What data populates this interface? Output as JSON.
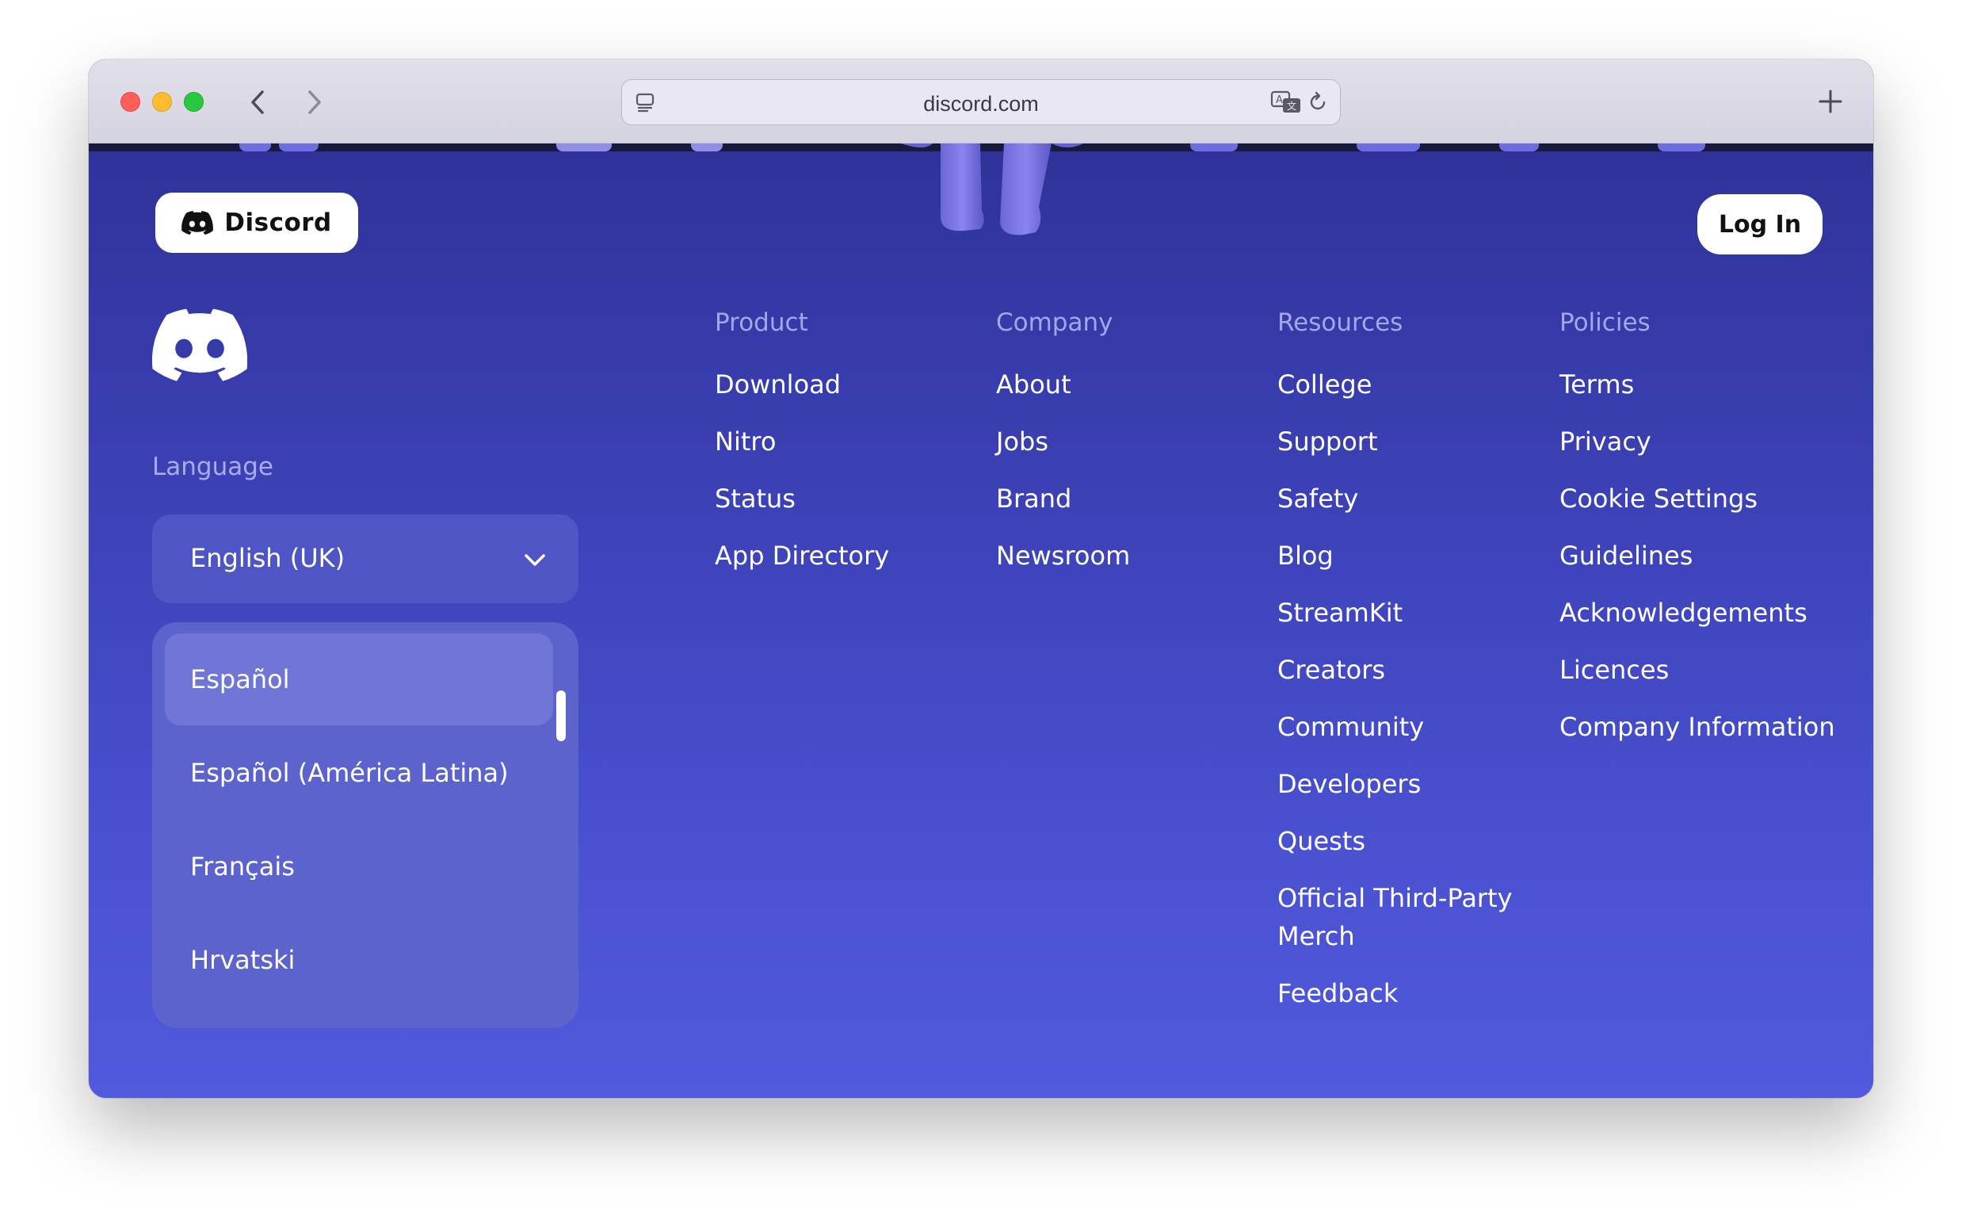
{
  "browser": {
    "url": "discord.com"
  },
  "header": {
    "brand_label": "Discord",
    "login_label": "Log In"
  },
  "language": {
    "label": "Language",
    "selected": "English (UK)",
    "options": [
      "Español",
      "Español (América Latina)",
      "Français",
      "Hrvatski"
    ],
    "highlighted": "Español"
  },
  "footer": {
    "columns": [
      {
        "title": "Product",
        "links": [
          "Download",
          "Nitro",
          "Status",
          "App Directory"
        ]
      },
      {
        "title": "Company",
        "links": [
          "About",
          "Jobs",
          "Brand",
          "Newsroom"
        ]
      },
      {
        "title": "Resources",
        "links": [
          "College",
          "Support",
          "Safety",
          "Blog",
          "StreamKit",
          "Creators",
          "Community",
          "Developers",
          "Quests",
          "Official Third-Party Merch",
          "Feedback"
        ]
      },
      {
        "title": "Policies",
        "links": [
          "Terms",
          "Privacy",
          "Cookie Settings",
          "Guidelines",
          "Acknowledgements",
          "Licences",
          "Company Information"
        ]
      }
    ]
  },
  "colors": {
    "page_gradient_top": "#2f3298",
    "page_gradient_bottom": "#5159dc",
    "blurple": "#5865f2"
  },
  "icons": [
    "back-icon",
    "forward-icon",
    "site-settings-icon",
    "translate-icon",
    "reload-icon",
    "new-tab-icon",
    "discord-logo-icon",
    "chevron-down-icon"
  ]
}
